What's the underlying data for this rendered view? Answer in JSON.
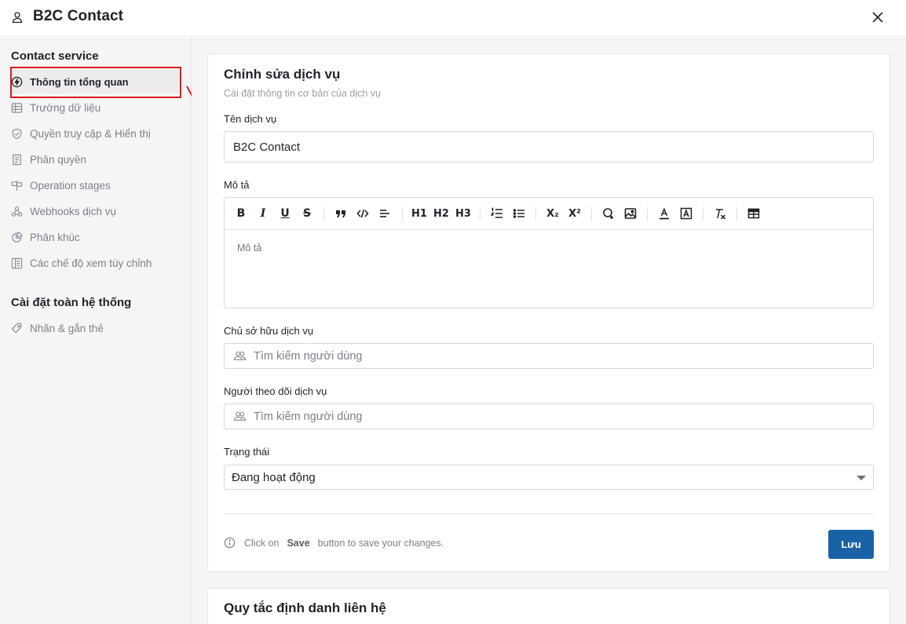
{
  "header": {
    "title": "B2C Contact"
  },
  "sidebar": {
    "section1": "Contact service",
    "items": [
      {
        "label": "Thông tin tổng quan",
        "icon": "lightning-icon",
        "active": true
      },
      {
        "label": "Trường dữ liệu",
        "icon": "table-icon"
      },
      {
        "label": "Quyền truy cập & Hiển thị",
        "icon": "shield-check-icon"
      },
      {
        "label": "Phân quyền",
        "icon": "list-check-icon"
      },
      {
        "label": "Operation stages",
        "icon": "signpost-icon"
      },
      {
        "label": "Webhooks dịch vụ",
        "icon": "webhook-icon"
      },
      {
        "label": "Phân khúc",
        "icon": "pie-chart-icon"
      },
      {
        "label": "Các chế độ xem tùy chỉnh",
        "icon": "layout-icon"
      }
    ],
    "section2": "Cài đặt toàn hệ thống",
    "items2": [
      {
        "label": "Nhãn & gắn thẻ",
        "icon": "tag-icon"
      }
    ]
  },
  "form": {
    "title": "Chỉnh sửa dịch vụ",
    "subtitle": "Cài đặt thông tin cơ bản của dịch vụ",
    "name_label": "Tên dịch vụ",
    "name_value": "B2C Contact",
    "desc_label": "Mô tả",
    "desc_placeholder": "Mô tả",
    "owner_label": "Chủ sở hữu dịch vụ",
    "owner_placeholder": "Tìm kiếm người dùng",
    "follower_label": "Người theo dõi dịch vụ",
    "follower_placeholder": "Tìm kiếm người dùng",
    "status_label": "Trạng thái",
    "status_value": "Đang hoạt động",
    "hint_pre": "Click on",
    "hint_bold": "Save",
    "hint_post": "button to save your changes.",
    "save_label": "Lưu"
  },
  "toolbar": {
    "bold": "B",
    "italic": "I",
    "underline": "U",
    "strike": "S",
    "h1": "H1",
    "h2": "H2",
    "h3": "H3",
    "sub": "X₂",
    "sup": "X²"
  },
  "card2": {
    "title": "Quy tắc định danh liên hệ"
  },
  "colors": {
    "accent": "#1a62a6",
    "highlight": "#e01b1b"
  }
}
